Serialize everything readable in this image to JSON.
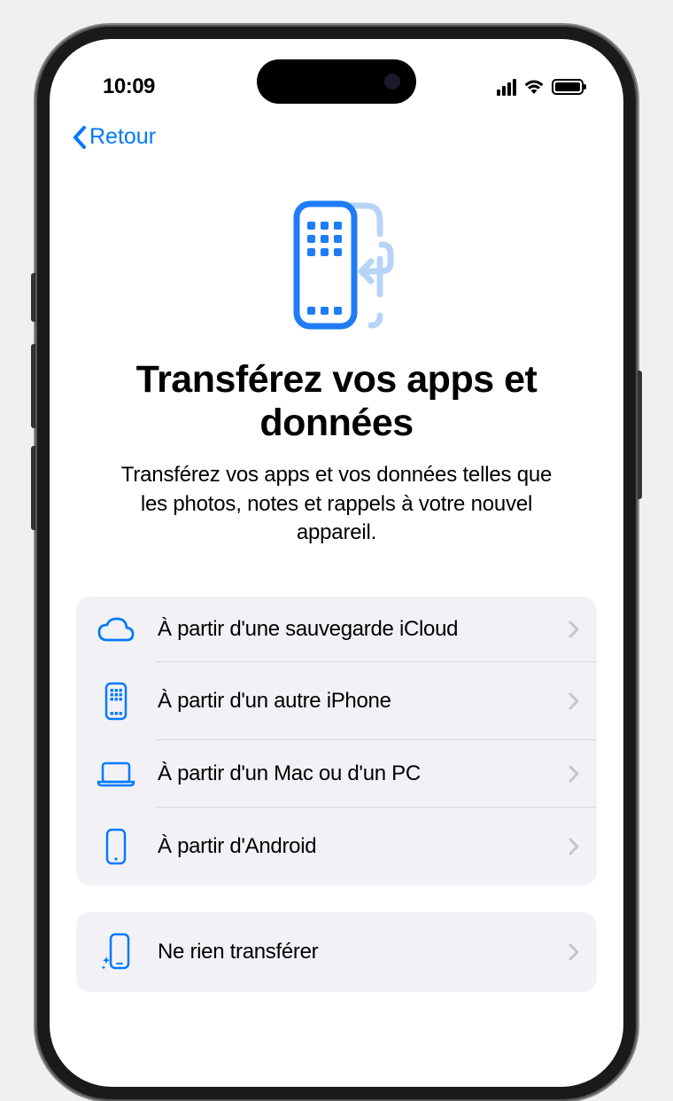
{
  "status_bar": {
    "time": "10:09"
  },
  "nav": {
    "back_label": "Retour"
  },
  "header": {
    "title": "Transférez vos apps et données",
    "subtitle": "Transférez vos apps et vos données telles que les photos, notes et rappels à votre nouvel appareil."
  },
  "options": [
    {
      "label": "À partir d'une sauvegarde iCloud",
      "icon": "cloud"
    },
    {
      "label": "À partir d'un autre iPhone",
      "icon": "iphone-apps"
    },
    {
      "label": "À partir d'un Mac ou d'un PC",
      "icon": "laptop"
    },
    {
      "label": "À partir d'Android",
      "icon": "smartphone"
    }
  ],
  "secondary_options": [
    {
      "label": "Ne rien transférer",
      "icon": "iphone-sparkle"
    }
  ],
  "colors": {
    "accent": "#007AFF",
    "accent_light": "#A7C8F5",
    "list_bg": "#f2f2f6",
    "chevron": "#c5c5c8"
  }
}
